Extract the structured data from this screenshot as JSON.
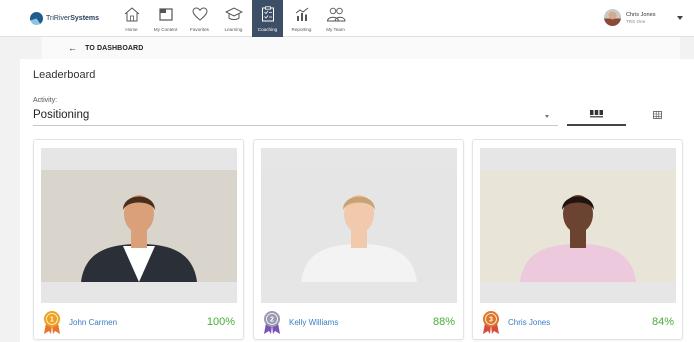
{
  "brand": {
    "name_light": "TriRiver",
    "name_bold": "Systems"
  },
  "nav": [
    {
      "label": "Home",
      "icon": "home-icon",
      "active": false
    },
    {
      "label": "My Content",
      "icon": "folder-icon",
      "active": false
    },
    {
      "label": "Favorites",
      "icon": "heart-icon",
      "active": false
    },
    {
      "label": "Learning",
      "icon": "graduation-cap-icon",
      "active": false
    },
    {
      "label": "Coaching",
      "icon": "clipboard-icon",
      "active": true
    },
    {
      "label": "Reporting",
      "icon": "chart-icon",
      "active": false
    },
    {
      "label": "My Team",
      "icon": "team-icon",
      "active": false
    }
  ],
  "user": {
    "name": "Chris Jones",
    "org": "TRS One"
  },
  "back_link": "TO DASHBOARD",
  "page_title": "Leaderboard",
  "activity": {
    "label": "Activity:",
    "value": "Positioning"
  },
  "view_toggle": {
    "card_icon": "grid-view-icon",
    "table_icon": "table-view-icon",
    "selected": "card"
  },
  "cards": [
    {
      "name": "John Carmen",
      "score": "100%",
      "rank": "1",
      "badge_color": "#f0a020",
      "ribbon_color": "#e8762c",
      "bg": "#d9d4cc",
      "skin": "#d9a07a",
      "hair": "#4a2e1d",
      "shirt": "#ffffff",
      "jacket": "#2b3038"
    },
    {
      "name": "Kelly Williams",
      "score": "88%",
      "rank": "2",
      "badge_color": "#9b9bb0",
      "ribbon_color": "#7b53b6",
      "bg": "#e5e5e5",
      "skin": "#f1c9ac",
      "hair": "#c9a274",
      "shirt": "#f3f3f3",
      "jacket": "#f3f3f3"
    },
    {
      "name": "Chris Jones",
      "score": "84%",
      "rank": "3",
      "badge_color": "#e0762b",
      "ribbon_color": "#d94c3a",
      "bg": "#e9e4d8",
      "skin": "#6b4330",
      "hair": "#1e1410",
      "shirt": "#ecc9dc",
      "jacket": "#ecc9dc"
    }
  ]
}
